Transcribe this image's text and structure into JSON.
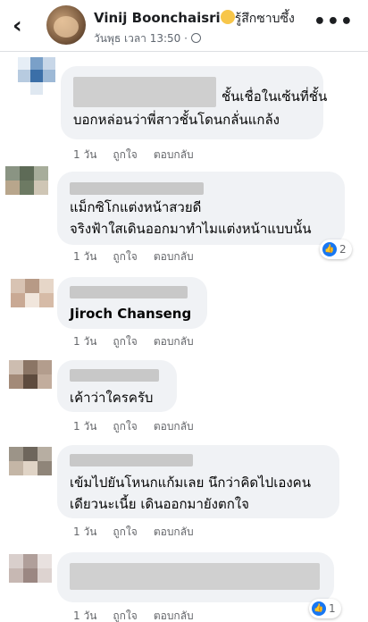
{
  "header": {
    "back_icon": "chevron-left-icon",
    "name": "Vinij Boonchaisri",
    "feeling_emoji": "smiling-face-icon",
    "feeling": "รู้สึกซาบซึ้ง",
    "timestamp": "วันพุธ เวลา 13:50 ·",
    "privacy_icon": "globe-icon",
    "more_icon": "more-icon"
  },
  "comments": [
    {
      "lines": [
        "ชั้นเชื่อในเซ้นที่ชั้น",
        "บอกหล่อนว่าพี่สาวชั้นโดนกลั่นแกล้ง"
      ],
      "time": "1 วัน",
      "like": "ถูกใจ",
      "reply": "ตอบกลับ"
    },
    {
      "lines": [
        "แม็กซิโกแต่งหน้าสวยดี",
        "จริงฟ้าใสเดินออกมาทำไมแต่งหน้าแบบนั้น"
      ],
      "time": "1 วัน",
      "like": "ถูกใจ",
      "reply": "ตอบกลับ",
      "reaction_count": "2"
    },
    {
      "name": "Jiroch Chanseng",
      "time": "1 วัน",
      "like": "ถูกใจ",
      "reply": "ตอบกลับ"
    },
    {
      "lines": [
        "เค้าว่าใครครับ"
      ],
      "time": "1 วัน",
      "like": "ถูกใจ",
      "reply": "ตอบกลับ"
    },
    {
      "lines": [
        "เข้มไปยันโหนกแก้มเลย นึกว่าคิดไปเองคน",
        "เดียวนะเนี้ย เดินออกมายังตกใจ"
      ],
      "time": "1 วัน",
      "like": "ถูกใจ",
      "reply": "ตอบกลับ"
    },
    {
      "time": "1 วัน",
      "like": "ถูกใจ",
      "reply": "ตอบกลับ",
      "reaction_count": "1"
    }
  ],
  "colors": {
    "bubble": "#f0f2f5",
    "like_blue": "#1877f2",
    "meta_gray": "#65676b"
  }
}
